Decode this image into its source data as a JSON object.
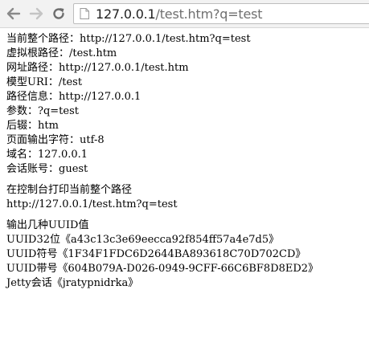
{
  "browser": {
    "url_host": "127.0.0.1",
    "url_path": "/test.htm?q=test"
  },
  "page": {
    "lines": [
      "当前整个路径：http://127.0.0.1/test.htm?q=test",
      "虚拟根路径：/test.htm",
      "网址路径：http://127.0.0.1/test.htm",
      "模型URI：/test",
      "路径信息：http://127.0.0.1",
      "参数：?q=test",
      "后辍：htm",
      "页面输出字符：utf-8",
      "域名：127.0.0.1",
      "会话账号：guest"
    ],
    "console_heading": "在控制台打印当前整个路径",
    "console_value": "http://127.0.0.1/test.htm?q=test",
    "uuid_heading": "输出几种UUID值",
    "uuid_lines": [
      "UUID32位《a43c13c3e69eecca92f854ff57a4e7d5》",
      "UUID符号《1F34F1FDC6D2644BA893618C70D702CD》",
      "UUID带号《604B079A-D026-0949-9CFF-66C6BF8D8ED2》",
      "Jetty会话《jratypnidrka》"
    ]
  }
}
